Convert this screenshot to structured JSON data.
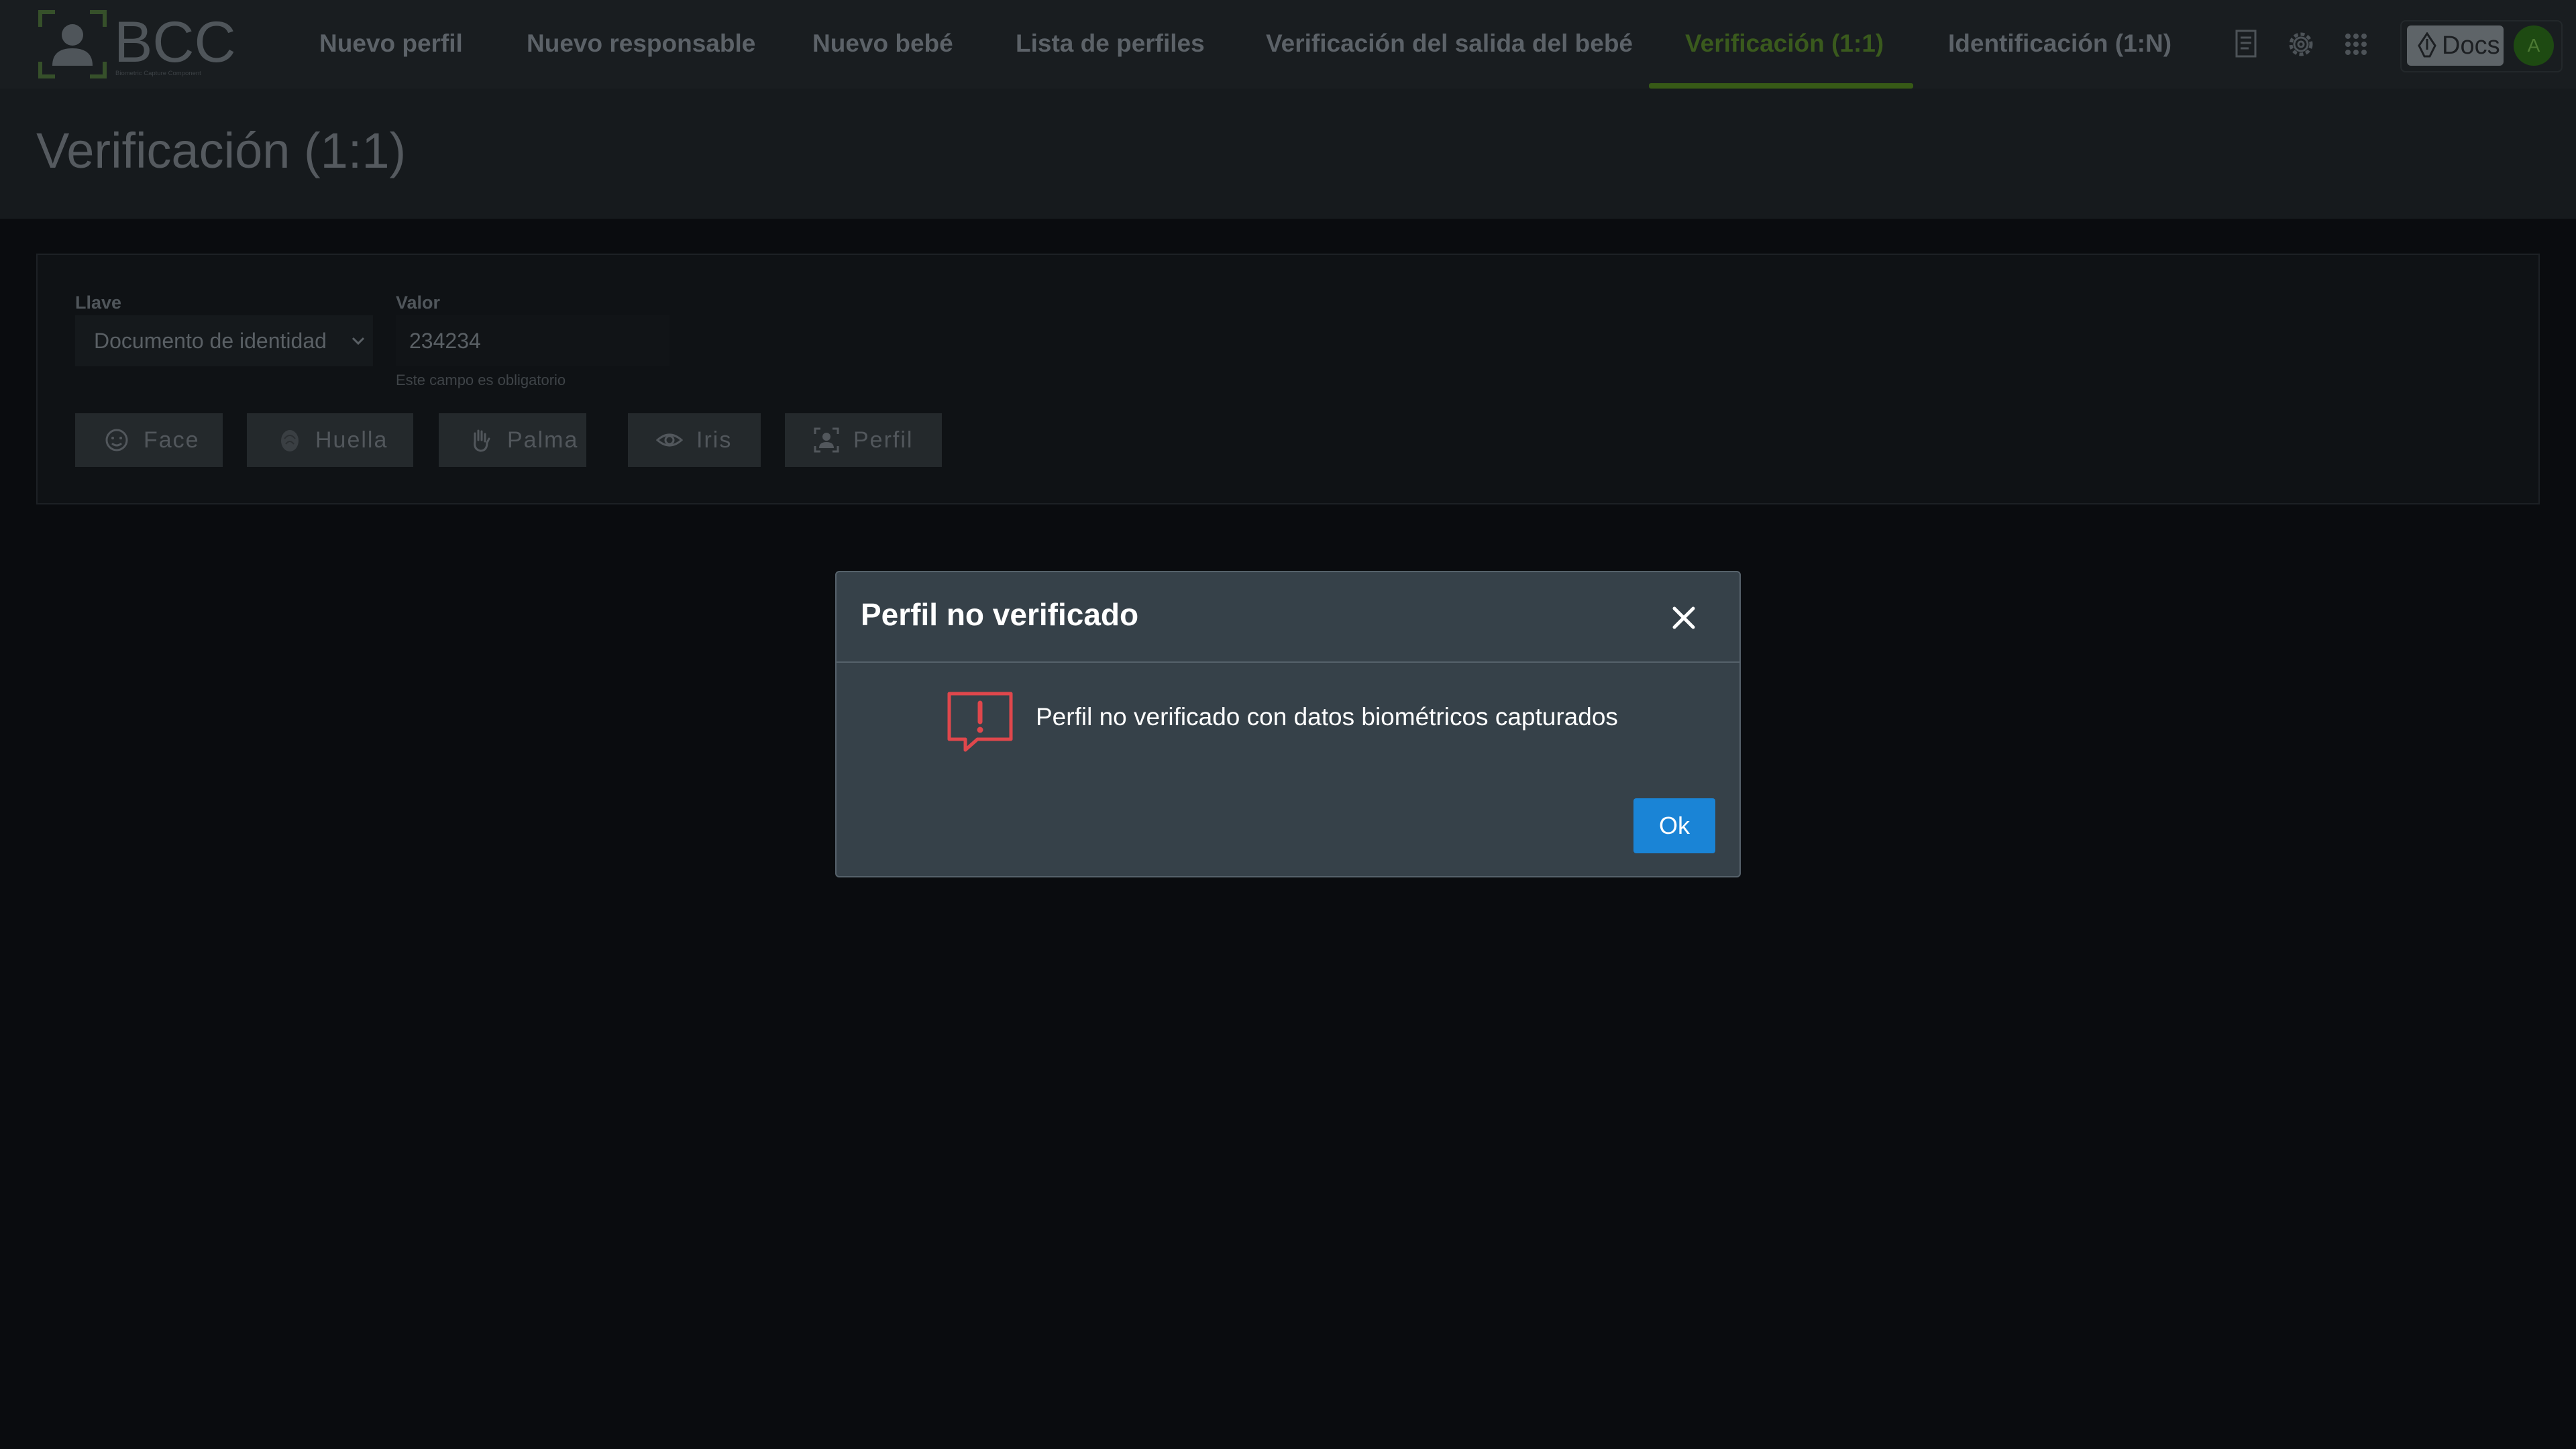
{
  "app": {
    "logo_text": "BCC",
    "logo_subtitle": "Biometric Capture Component"
  },
  "nav": {
    "items": [
      {
        "label": "Nuevo perfil"
      },
      {
        "label": "Nuevo responsable"
      },
      {
        "label": "Nuevo bebé"
      },
      {
        "label": "Lista de perfiles"
      },
      {
        "label": "Verificación del salida del bebé"
      },
      {
        "label": "Verificación (1:1)",
        "active": true
      },
      {
        "label": "Identificación (1:N)"
      }
    ],
    "icons": [
      "document-icon",
      "gear-icon",
      "apps-grid-icon"
    ],
    "docs_label": "Docs",
    "avatar_initial": "A"
  },
  "page": {
    "title": "Verificación (1:1)"
  },
  "form": {
    "key_label": "Llave",
    "key_value": "Documento de identidad",
    "value_label": "Valor",
    "value": "234234",
    "hint": "Este campo es obligatorio",
    "buttons": [
      {
        "label": "Face",
        "icon": "face-icon"
      },
      {
        "label": "Huella",
        "icon": "fingerprint-icon"
      },
      {
        "label": "Palma",
        "icon": "palm-icon"
      },
      {
        "label": "Iris",
        "icon": "eye-icon"
      },
      {
        "label": "Perfil",
        "icon": "profile-scan-icon"
      }
    ]
  },
  "modal": {
    "title": "Perfil no verificado",
    "message": "Perfil no verificado con datos biométricos capturados",
    "ok_label": "Ok",
    "icon": "alert-message-icon"
  },
  "colors": {
    "active_nav": "#3a5a1d",
    "accent_button": "#1a84d6",
    "alert_icon": "#e0474c",
    "modal_bg": "#364149"
  }
}
